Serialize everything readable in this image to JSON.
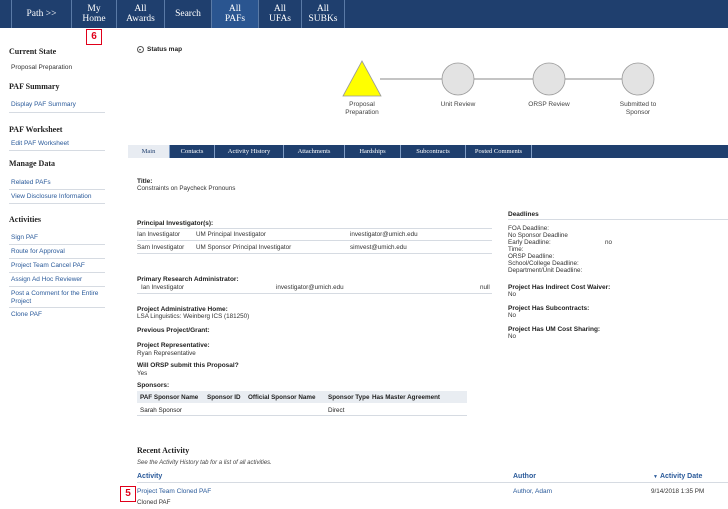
{
  "nav": {
    "items": [
      {
        "key": "path",
        "line1": "Path >>",
        "line2": ""
      },
      {
        "key": "home",
        "line1": "My",
        "line2": "Home"
      },
      {
        "key": "awards",
        "line1": "All",
        "line2": "Awards"
      },
      {
        "key": "search",
        "line1": "Search",
        "line2": ""
      },
      {
        "key": "pafs",
        "line1": "All",
        "line2": "PAFs"
      },
      {
        "key": "ufas",
        "line1": "All",
        "line2": "UFAs"
      },
      {
        "key": "subks",
        "line1": "All",
        "line2": "SUBKs"
      }
    ]
  },
  "badges": {
    "home": "6",
    "activity": "5"
  },
  "sidebar": {
    "current_state_heading": "Current State",
    "current_state": "Proposal Preparation",
    "paf_summary_heading": "PAF Summary",
    "display_paf_summary": "Display PAF Summary",
    "paf_worksheet_heading": "PAF Worksheet",
    "edit_paf_worksheet": "Edit PAF Worksheet",
    "manage_data_heading": "Manage Data",
    "related_pafs": "Related PAFs",
    "view_disclosure": "View Disclosure Information",
    "activities_heading": "Activities",
    "activities": [
      "Sign PAF",
      "Route for Approval",
      "Project Team Cancel PAF",
      "Assign Ad Hoc Reviewer",
      "Post a Comment for the Entire Project",
      "Clone PAF"
    ]
  },
  "status_map": {
    "toggle_label": "Status map",
    "stages": [
      "Proposal\nPreparation",
      "Unit Review",
      "ORSP Review",
      "Submitted to\nSponsor"
    ],
    "active_color": "#ffff00"
  },
  "tabs": [
    "Main",
    "Contacts",
    "Activity History",
    "Attachments",
    "Hardships",
    "Subcontracts",
    "Posted Comments"
  ],
  "main": {
    "title_label": "Title:",
    "title_value": "Constraints on Paycheck Pronouns",
    "pi_label": "Principal Investigator(s):",
    "pis": [
      {
        "name": "Ian Investigator",
        "role": "UM Principal Investigator",
        "email": "investigator@umich.edu"
      },
      {
        "name": "Sam Investigator",
        "role": "UM Sponsor Principal Investigator",
        "email": "simvest@umich.edu"
      }
    ],
    "pra_label": "Primary Research Administrator:",
    "pra_name": "Ian Investigator",
    "pra_email": "investigator@umich.edu",
    "pra_null": "null",
    "admin_home_label": "Project Administrative Home:",
    "admin_home_value": "LSA Linguistics: Weinberg ICS  (181250)",
    "prev_project_label": "Previous Project/Grant:",
    "rep_label": "Project Representative:",
    "rep_value": "Ryan Representative",
    "orsp_submit_label": "Will ORSP submit this Proposal?",
    "orsp_submit_value": "Yes",
    "sponsors_label": "Sponsors:",
    "sponsor_columns": [
      "PAF Sponsor Name",
      "Sponsor ID",
      "Official Sponsor Name",
      "Sponsor Type",
      "Has Master Agreement"
    ],
    "sponsor_rows": [
      [
        "Sarah Sponsor",
        "",
        "",
        "Direct",
        ""
      ]
    ]
  },
  "deadlines": {
    "heading": "Deadlines",
    "foa_deadline": "FOA Deadline:",
    "no_sponsor_deadline": "No Sponsor Deadline",
    "early_deadline": "Early Deadline:",
    "early_value": "no",
    "time": "Time:",
    "orsp_deadline": "ORSP Deadline:",
    "school_deadline": "School/College Deadline:",
    "dept_deadline": "Department/Unit Deadline:",
    "icw_label": "Project Has Indirect Cost Waiver:",
    "icw_value": "No",
    "subk_label": "Project Has Subcontracts:",
    "subk_value": "No",
    "cost_sharing_label": "Project Has UM Cost Sharing:",
    "cost_sharing_value": "No"
  },
  "recent_activity": {
    "heading": "Recent Activity",
    "note": "See the Activity History tab for a list of all activities.",
    "columns": {
      "activity": "Activity",
      "author": "Author",
      "date": "Activity Date"
    },
    "rows": [
      {
        "activity": "Project Team Cloned PAF",
        "detail": "Cloned PAF",
        "author": "Author, Adam",
        "date": "9/14/2018 1:35 PM"
      }
    ]
  }
}
